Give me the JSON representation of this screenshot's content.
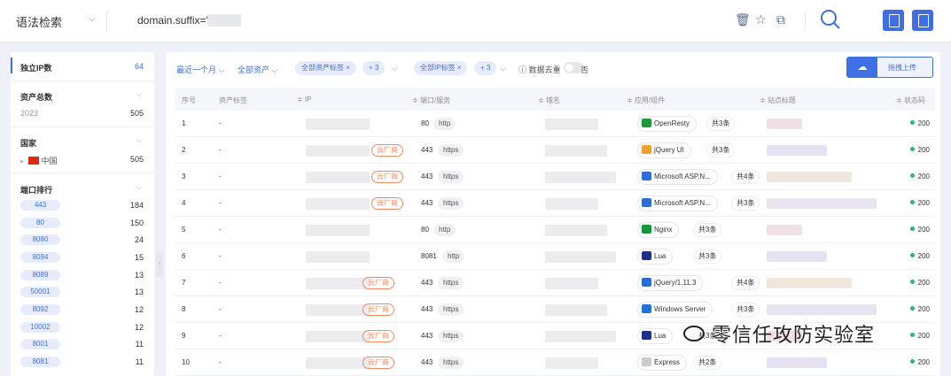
{
  "topbar": {
    "syntax_select": "语法检索",
    "query_text": "domain.suffix='"
  },
  "sidebar": {
    "independent_ip": {
      "label": "独立IP数",
      "value": "64"
    },
    "asset_total": {
      "label": "资产总数",
      "year": "2023",
      "value": "505"
    },
    "country": {
      "label": "国家",
      "name": "中国",
      "value": "505"
    },
    "ports": {
      "label": "端口排行",
      "items": [
        {
          "port": "443",
          "count": "184"
        },
        {
          "port": "80",
          "count": "150"
        },
        {
          "port": "8080",
          "count": "24"
        },
        {
          "port": "8094",
          "count": "15"
        },
        {
          "port": "8089",
          "count": "13"
        },
        {
          "port": "50001",
          "count": "13"
        },
        {
          "port": "8092",
          "count": "12"
        },
        {
          "port": "10002",
          "count": "12"
        },
        {
          "port": "8001",
          "count": "11"
        },
        {
          "port": "8081",
          "count": "11"
        }
      ]
    }
  },
  "filters": {
    "time": "最近一个月",
    "assets": "全部资产",
    "asset_tag": "全部资产标签",
    "asset_tag_more": "+ 3",
    "ip_tag": "全部IP标签",
    "ip_tag_more": "+ 3",
    "dedupe_label": "数据去重",
    "dedupe_value": "否",
    "upload_label": "拖拽上传"
  },
  "table": {
    "headers": {
      "index": "序号",
      "asset_tag": "资产标签",
      "ip": "IP",
      "port_service": "端口/服务",
      "domain": "域名",
      "app": "应用/组件",
      "site_title": "站点标题",
      "status": "状态码"
    },
    "rows": [
      {
        "index": "1",
        "tag": "-",
        "cloud": "",
        "port": "80",
        "proto": "http",
        "app": "OpenResty",
        "app_icon_color": "#1f9a3a",
        "total": "共3条",
        "status": "200"
      },
      {
        "index": "2",
        "tag": "-",
        "cloud": "云厂商",
        "port": "443",
        "proto": "https",
        "app": "jQuery UI",
        "app_icon_color": "#f0a030",
        "total": "共3条",
        "status": "200"
      },
      {
        "index": "3",
        "tag": "-",
        "cloud": "云厂商",
        "port": "443",
        "proto": "https",
        "app": "Microsoft ASP.N...",
        "app_icon_color": "#2b6cd6",
        "total": "共4条",
        "status": "200"
      },
      {
        "index": "4",
        "tag": "-",
        "cloud": "云厂商",
        "port": "443",
        "proto": "https",
        "app": "Microsoft ASP.N...",
        "app_icon_color": "#2b6cd6",
        "total": "共3条",
        "status": "200"
      },
      {
        "index": "5",
        "tag": "-",
        "cloud": "",
        "port": "80",
        "proto": "http",
        "app": "Nginx",
        "app_icon_color": "#119a3a",
        "total": "共3条",
        "status": "200"
      },
      {
        "index": "6",
        "tag": "-",
        "cloud": "",
        "port": "8081",
        "proto": "http",
        "app": "Lua",
        "app_icon_color": "#1d2f8a",
        "total": "共3条",
        "status": "200"
      },
      {
        "index": "7",
        "tag": "-",
        "cloud": "云厂商",
        "port": "443",
        "proto": "https",
        "app": "jQuery/1.11.3",
        "app_icon_color": "#2b6cd6",
        "total": "共4条",
        "status": "200"
      },
      {
        "index": "8",
        "tag": "-",
        "cloud": "云厂商",
        "port": "443",
        "proto": "https",
        "app": "Windows Server",
        "app_icon_color": "#1e73d8",
        "total": "共3条",
        "status": "200"
      },
      {
        "index": "9",
        "tag": "-",
        "cloud": "云厂商",
        "port": "443",
        "proto": "https",
        "app": "Lua",
        "app_icon_color": "#1d2f8a",
        "total": "共3条",
        "status": "200"
      },
      {
        "index": "10",
        "tag": "-",
        "cloud": "云厂商",
        "port": "443",
        "proto": "https",
        "app": "Express",
        "app_icon_color": "#cccccc",
        "total": "共2条",
        "status": "200"
      }
    ]
  },
  "watermark": "零信任攻防实验室"
}
